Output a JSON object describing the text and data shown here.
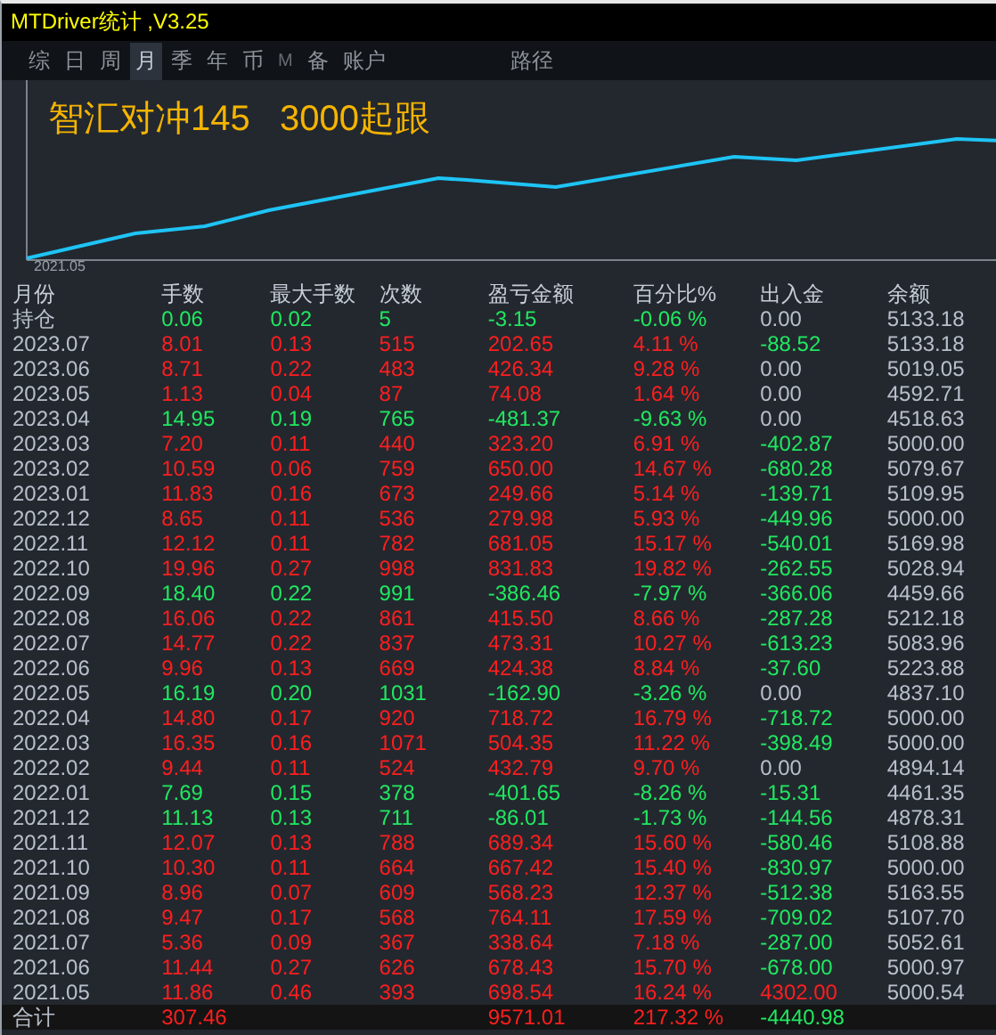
{
  "window": {
    "title": "MTDriver统计 ,V3.25"
  },
  "tabs": [
    {
      "label": "综",
      "selected": false
    },
    {
      "label": "日",
      "selected": false
    },
    {
      "label": "周",
      "selected": false
    },
    {
      "label": "月",
      "selected": true
    },
    {
      "label": "季",
      "selected": false
    },
    {
      "label": "年",
      "selected": false
    },
    {
      "label": "币",
      "selected": false
    },
    {
      "label": "M",
      "selected": false,
      "kind": "dim"
    },
    {
      "label": "备",
      "selected": false
    },
    {
      "label": "账户",
      "selected": false
    },
    {
      "label": "路径",
      "selected": false,
      "kind": "far"
    }
  ],
  "chart": {
    "title": "智汇对冲145   3000起跟",
    "start_label": "2021.05"
  },
  "table": {
    "columns": [
      "月份",
      "手数",
      "最大手数",
      "次数",
      "盈亏金额",
      "百分比%",
      "出入金",
      "余额"
    ],
    "rows": [
      {
        "cells": [
          "持仓",
          "0.06",
          "0.02",
          "5",
          "-3.15",
          "-0.06 %"
        ],
        "loss": true,
        "flow": {
          "value": "0.00",
          "color": "#b9c0cb"
        },
        "balance": "5133.18"
      },
      {
        "cells": [
          "2023.07",
          "8.01",
          "0.13",
          "515",
          "202.65",
          "4.11 %"
        ],
        "loss": false,
        "flow": {
          "value": "-88.52",
          "color": "#20e860"
        },
        "balance": "5133.18"
      },
      {
        "cells": [
          "2023.06",
          "8.71",
          "0.22",
          "483",
          "426.34",
          "9.28 %"
        ],
        "loss": false,
        "flow": {
          "value": "0.00",
          "color": "#b9c0cb"
        },
        "balance": "5019.05"
      },
      {
        "cells": [
          "2023.05",
          "1.13",
          "0.04",
          "87",
          "74.08",
          "1.64 %"
        ],
        "loss": false,
        "flow": {
          "value": "0.00",
          "color": "#b9c0cb"
        },
        "balance": "4592.71"
      },
      {
        "cells": [
          "2023.04",
          "14.95",
          "0.19",
          "765",
          "-481.37",
          "-9.63 %"
        ],
        "loss": true,
        "flow": {
          "value": "0.00",
          "color": "#b9c0cb"
        },
        "balance": "4518.63"
      },
      {
        "cells": [
          "2023.03",
          "7.20",
          "0.11",
          "440",
          "323.20",
          "6.91 %"
        ],
        "loss": false,
        "flow": {
          "value": "-402.87",
          "color": "#20e860"
        },
        "balance": "5000.00"
      },
      {
        "cells": [
          "2023.02",
          "10.59",
          "0.06",
          "759",
          "650.00",
          "14.67 %"
        ],
        "loss": false,
        "flow": {
          "value": "-680.28",
          "color": "#20e860"
        },
        "balance": "5079.67"
      },
      {
        "cells": [
          "2023.01",
          "11.83",
          "0.16",
          "673",
          "249.66",
          "5.14 %"
        ],
        "loss": false,
        "flow": {
          "value": "-139.71",
          "color": "#20e860"
        },
        "balance": "5109.95"
      },
      {
        "cells": [
          "2022.12",
          "8.65",
          "0.11",
          "536",
          "279.98",
          "5.93 %"
        ],
        "loss": false,
        "flow": {
          "value": "-449.96",
          "color": "#20e860"
        },
        "balance": "5000.00"
      },
      {
        "cells": [
          "2022.11",
          "12.12",
          "0.11",
          "782",
          "681.05",
          "15.17 %"
        ],
        "loss": false,
        "flow": {
          "value": "-540.01",
          "color": "#20e860"
        },
        "balance": "5169.98"
      },
      {
        "cells": [
          "2022.10",
          "19.96",
          "0.27",
          "998",
          "831.83",
          "19.82 %"
        ],
        "loss": false,
        "flow": {
          "value": "-262.55",
          "color": "#20e860"
        },
        "balance": "5028.94"
      },
      {
        "cells": [
          "2022.09",
          "18.40",
          "0.22",
          "991",
          "-386.46",
          "-7.97 %"
        ],
        "loss": true,
        "flow": {
          "value": "-366.06",
          "color": "#20e860"
        },
        "balance": "4459.66"
      },
      {
        "cells": [
          "2022.08",
          "16.06",
          "0.22",
          "861",
          "415.50",
          "8.66 %"
        ],
        "loss": false,
        "flow": {
          "value": "-287.28",
          "color": "#20e860"
        },
        "balance": "5212.18"
      },
      {
        "cells": [
          "2022.07",
          "14.77",
          "0.22",
          "837",
          "473.31",
          "10.27 %"
        ],
        "loss": false,
        "flow": {
          "value": "-613.23",
          "color": "#20e860"
        },
        "balance": "5083.96"
      },
      {
        "cells": [
          "2022.06",
          "9.96",
          "0.13",
          "669",
          "424.38",
          "8.84 %"
        ],
        "loss": false,
        "flow": {
          "value": "-37.60",
          "color": "#20e860"
        },
        "balance": "5223.88"
      },
      {
        "cells": [
          "2022.05",
          "16.19",
          "0.20",
          "1031",
          "-162.90",
          "-3.26 %"
        ],
        "loss": true,
        "flow": {
          "value": "0.00",
          "color": "#b9c0cb"
        },
        "balance": "4837.10"
      },
      {
        "cells": [
          "2022.04",
          "14.80",
          "0.17",
          "920",
          "718.72",
          "16.79 %"
        ],
        "loss": false,
        "flow": {
          "value": "-718.72",
          "color": "#20e860"
        },
        "balance": "5000.00"
      },
      {
        "cells": [
          "2022.03",
          "16.35",
          "0.16",
          "1071",
          "504.35",
          "11.22 %"
        ],
        "loss": false,
        "flow": {
          "value": "-398.49",
          "color": "#20e860"
        },
        "balance": "5000.00"
      },
      {
        "cells": [
          "2022.02",
          "9.44",
          "0.11",
          "524",
          "432.79",
          "9.70 %"
        ],
        "loss": false,
        "flow": {
          "value": "0.00",
          "color": "#b9c0cb"
        },
        "balance": "4894.14"
      },
      {
        "cells": [
          "2022.01",
          "7.69",
          "0.15",
          "378",
          "-401.65",
          "-8.26 %"
        ],
        "loss": true,
        "flow": {
          "value": "-15.31",
          "color": "#20e860"
        },
        "balance": "4461.35"
      },
      {
        "cells": [
          "2021.12",
          "11.13",
          "0.13",
          "711",
          "-86.01",
          "-1.73 %"
        ],
        "loss": true,
        "flow": {
          "value": "-144.56",
          "color": "#20e860"
        },
        "balance": "4878.31"
      },
      {
        "cells": [
          "2021.11",
          "12.07",
          "0.13",
          "788",
          "689.34",
          "15.60 %"
        ],
        "loss": false,
        "flow": {
          "value": "-580.46",
          "color": "#20e860"
        },
        "balance": "5108.88"
      },
      {
        "cells": [
          "2021.10",
          "10.30",
          "0.11",
          "664",
          "667.42",
          "15.40 %"
        ],
        "loss": false,
        "flow": {
          "value": "-830.97",
          "color": "#20e860"
        },
        "balance": "5000.00"
      },
      {
        "cells": [
          "2021.09",
          "8.96",
          "0.07",
          "609",
          "568.23",
          "12.37 %"
        ],
        "loss": false,
        "flow": {
          "value": "-512.38",
          "color": "#20e860"
        },
        "balance": "5163.55"
      },
      {
        "cells": [
          "2021.08",
          "9.47",
          "0.17",
          "568",
          "764.11",
          "17.59 %"
        ],
        "loss": false,
        "flow": {
          "value": "-709.02",
          "color": "#20e860"
        },
        "balance": "5107.70"
      },
      {
        "cells": [
          "2021.07",
          "5.36",
          "0.09",
          "367",
          "338.64",
          "7.18 %"
        ],
        "loss": false,
        "flow": {
          "value": "-287.00",
          "color": "#20e860"
        },
        "balance": "5052.61"
      },
      {
        "cells": [
          "2021.06",
          "11.44",
          "0.27",
          "626",
          "678.43",
          "15.70 %"
        ],
        "loss": false,
        "flow": {
          "value": "-678.00",
          "color": "#20e860"
        },
        "balance": "5000.97"
      },
      {
        "cells": [
          "2021.05",
          "11.86",
          "0.46",
          "393",
          "698.54",
          "16.24 %"
        ],
        "loss": false,
        "flow": {
          "value": "4302.00",
          "color": "#ff1e1e"
        },
        "balance": "5000.54"
      }
    ],
    "totals": {
      "label": "合计",
      "lots": "307.46",
      "pnl": "9571.01",
      "percent": "217.32 %",
      "flow": "-4440.98"
    }
  }
}
